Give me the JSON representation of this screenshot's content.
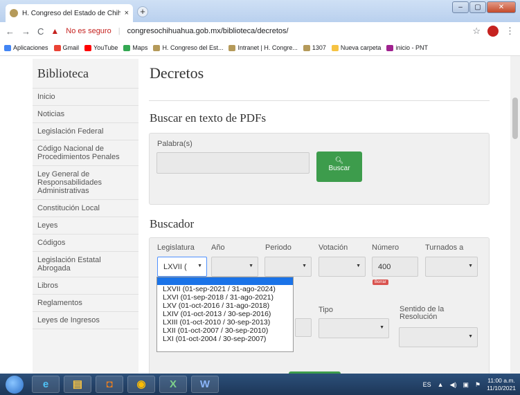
{
  "browser": {
    "tab_title": "H. Congreso del Estado de Chihu",
    "tab_close": "×",
    "new_tab": "+",
    "insecure_label": "No es seguro",
    "url": "congresochihuahua.gob.mx/biblioteca/decretos/",
    "bookmarks": [
      "Aplicaciones",
      "Gmail",
      "YouTube",
      "Maps",
      "H. Congreso del Est...",
      "Intranet | H. Congre...",
      "1307",
      "Nueva carpeta",
      "inicio - PNT"
    ]
  },
  "sidebar": {
    "title": "Biblioteca",
    "items": [
      "Inicio",
      "Noticias",
      "Legislación Federal",
      "Código Nacional de Procedimientos Penales",
      "Ley General de Responsabilidades Administrativas",
      "Constitución Local",
      "Leyes",
      "Códigos",
      "Legislación Estatal Abrogada",
      "Libros",
      "Reglamentos",
      "Leyes de Ingresos"
    ]
  },
  "main": {
    "title": "Decretos",
    "pdf_search": {
      "heading": "Buscar en texto de PDFs",
      "label": "Palabra(s)",
      "button_icon": "search-icon",
      "button_label": "Buscar"
    },
    "buscador": {
      "heading": "Buscador",
      "labels": [
        "Legislatura",
        "Año",
        "Periodo",
        "Votación",
        "Número",
        "Turnados a"
      ],
      "legislatura_value": "LXVII (",
      "numero_value": "400",
      "borrar_label": "Borrar",
      "tipo_label": "Tipo",
      "sentido_label": "Sentido de la Resolución"
    },
    "dropdown_options": [
      "LXVII (01-sep-2021 / 31-ago-2024)",
      "LXVI (01-sep-2018 / 31-ago-2021)",
      "LXV (01-oct-2016 / 31-ago-2018)",
      "LXIV (01-oct-2013 / 30-sep-2016)",
      "LXIII (01-oct-2010 / 30-sep-2013)",
      "LXII (01-oct-2007 / 30-sep-2010)",
      "LXI (01-oct-2004 / 30-sep-2007)"
    ]
  },
  "taskbar": {
    "lang": "ES",
    "time": "11:00 a.m.",
    "date": "11/10/2021"
  }
}
